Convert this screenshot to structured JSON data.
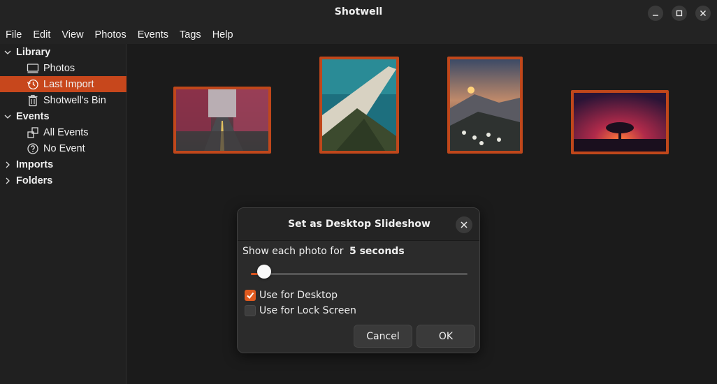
{
  "window": {
    "title": "Shotwell"
  },
  "menu": [
    "File",
    "Edit",
    "View",
    "Photos",
    "Events",
    "Tags",
    "Help"
  ],
  "sidebar": {
    "library": "Library",
    "photos": "Photos",
    "last_import": "Last Import",
    "bin": "Shotwell's Bin",
    "events": "Events",
    "all_events": "All Events",
    "no_event": "No Event",
    "imports": "Imports",
    "folders": "Folders"
  },
  "colors": {
    "accent": "#c7471c",
    "thumb_border": "#c0471b",
    "check": "#e05a1f"
  },
  "thumbnails": [
    {
      "name": "autumn-road",
      "orientation": "landscape"
    },
    {
      "name": "sea-spit-aerial",
      "orientation": "portrait"
    },
    {
      "name": "mountain-sunset",
      "orientation": "portrait"
    },
    {
      "name": "tree-red-sky",
      "orientation": "landscape"
    }
  ],
  "dialog": {
    "title": "Set as Desktop Slideshow",
    "show_label": "Show each photo for",
    "duration": "5 seconds",
    "slider_fraction": 0.06,
    "use_desktop": "Use for Desktop",
    "use_desktop_checked": true,
    "use_lock": "Use for Lock Screen",
    "use_lock_checked": false,
    "cancel": "Cancel",
    "ok": "OK"
  }
}
